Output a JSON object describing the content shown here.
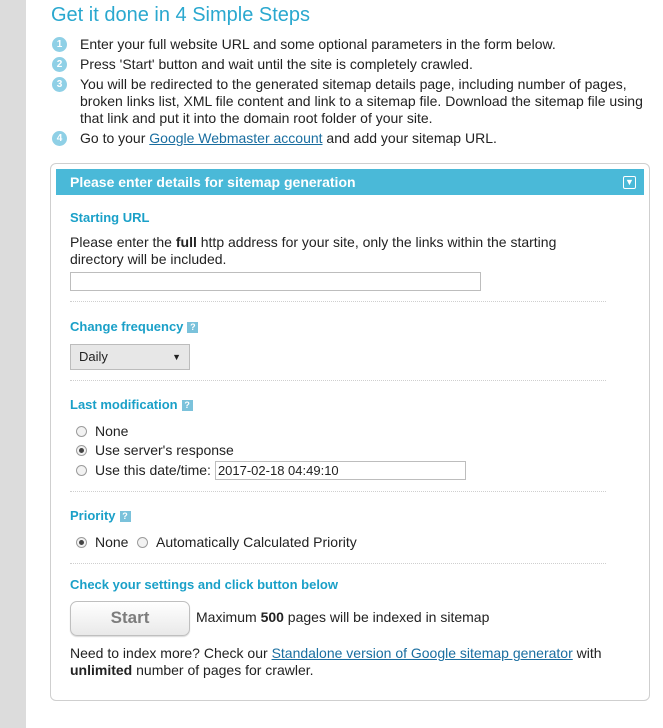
{
  "title": "Get it done in 4 Simple Steps",
  "steps": [
    {
      "num": "1",
      "text": "Enter your full website URL and some optional parameters in the form below."
    },
    {
      "num": "2",
      "text": "Press 'Start' button and wait until the site is completely crawled."
    },
    {
      "num": "3",
      "text": "You will be redirected to the generated sitemap details page, including number of pages, broken links list, XML file content and link to a sitemap file. Download the sitemap file using that link and put it into the domain root folder of your site."
    },
    {
      "num": "4",
      "text_before": "Go to your ",
      "link": "Google Webmaster account",
      "text_after": " and add your sitemap URL."
    }
  ],
  "panel": {
    "header": "Please enter details for sitemap generation",
    "starting_url": {
      "label": "Starting URL",
      "desc_before": "Please enter the ",
      "desc_bold": "full",
      "desc_after": " http address for your site, only the links within the starting directory will be included.",
      "value": ""
    },
    "change_frequency": {
      "label": "Change frequency",
      "help": "?",
      "selected": "Daily"
    },
    "last_modification": {
      "label": "Last modification",
      "help": "?",
      "options": [
        "None",
        "Use server's response",
        "Use this date/time:"
      ],
      "selected_index": 1,
      "date_value": "2017-02-18 04:49:10"
    },
    "priority": {
      "label": "Priority",
      "help": "?",
      "options": [
        "None",
        "Automatically Calculated Priority"
      ],
      "selected_index": 0
    },
    "check": {
      "label": "Check your settings and click button below",
      "button": "Start",
      "max_before": "Maximum ",
      "max_bold": "500",
      "max_after": " pages will be indexed in sitemap"
    },
    "more": {
      "before": "Need to index more? Check our ",
      "link": "Standalone version of Google sitemap generator",
      "after": " with",
      "bold": "unlimited",
      "end": " number of pages for crawler."
    }
  }
}
